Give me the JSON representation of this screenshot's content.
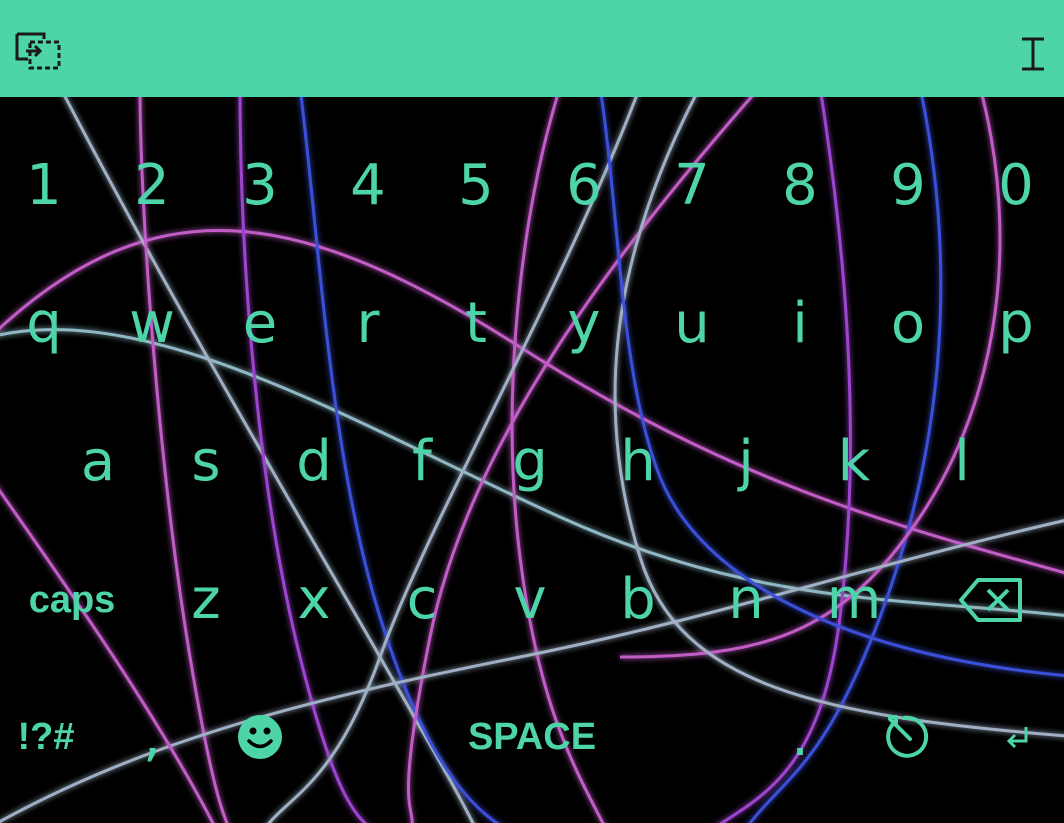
{
  "toolbar": {
    "left_icon": "keyboard-swap-icon",
    "right_icon": "text-cursor-icon"
  },
  "accent_color": "#4dd4a9",
  "keyboard": {
    "background": "neon-light-trails",
    "rows": [
      [
        "1",
        "2",
        "3",
        "4",
        "5",
        "6",
        "7",
        "8",
        "9",
        "0"
      ],
      [
        "q",
        "w",
        "e",
        "r",
        "t",
        "y",
        "u",
        "i",
        "o",
        "p"
      ],
      [
        "a",
        "s",
        "d",
        "f",
        "g",
        "h",
        "j",
        "k",
        "l"
      ],
      [
        "caps",
        "z",
        "x",
        "c",
        "v",
        "b",
        "n",
        "m",
        "backspace-icon"
      ],
      [
        "!?#",
        ",",
        "smiley-icon",
        "SPACE",
        ".",
        "history-icon",
        "enter-icon"
      ]
    ],
    "labels": {
      "caps": "caps",
      "symbols": "!?#",
      "comma": ",",
      "space": "SPACE",
      "period": "."
    }
  }
}
